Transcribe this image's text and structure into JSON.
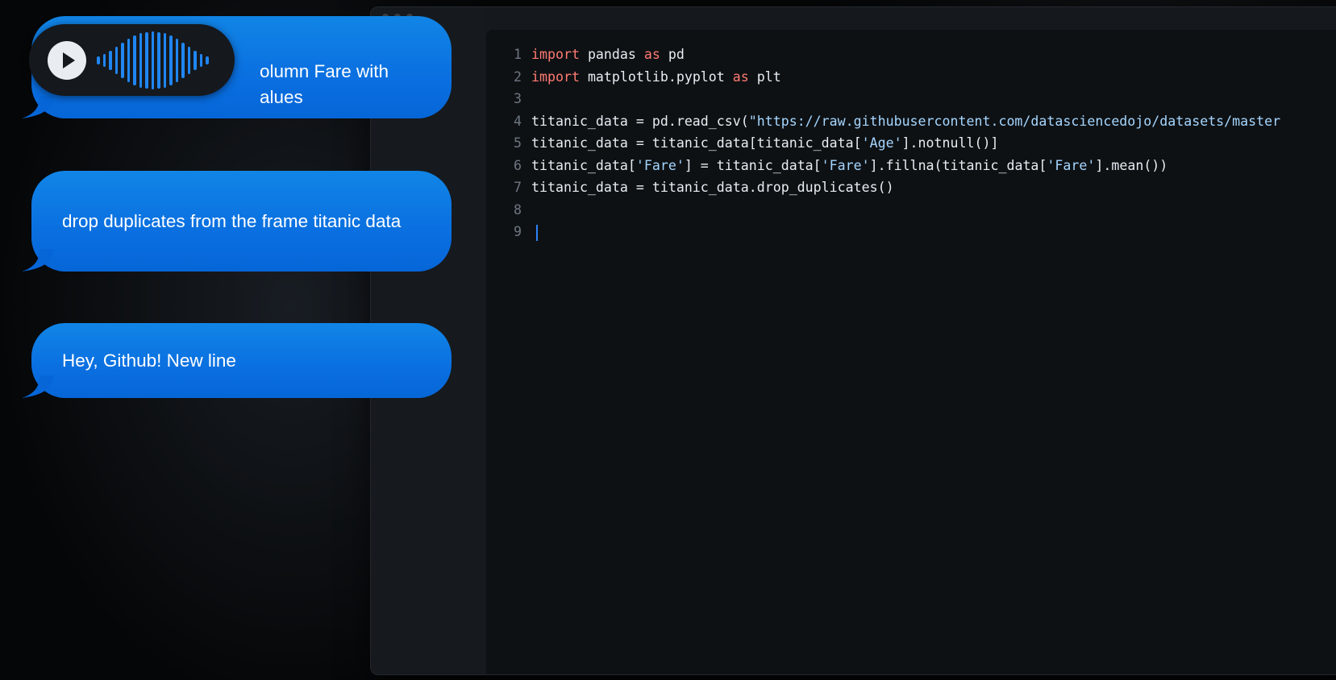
{
  "chat": {
    "messages": [
      {
        "line1": "olumn Fare with",
        "line2": "alues"
      },
      {
        "text": "drop duplicates from the frame titanic data"
      },
      {
        "text": "Hey, Github! New line"
      }
    ],
    "voice": {
      "icon": "play-icon"
    }
  },
  "editor": {
    "lines": [
      {
        "n": "1",
        "parts": [
          {
            "t": "import",
            "c": "kw"
          },
          {
            "t": " pandas "
          },
          {
            "t": "as",
            "c": "kw"
          },
          {
            "t": " pd"
          }
        ]
      },
      {
        "n": "2",
        "parts": [
          {
            "t": "import",
            "c": "kw"
          },
          {
            "t": " matplotlib.pyplot "
          },
          {
            "t": "as",
            "c": "kw"
          },
          {
            "t": " plt"
          }
        ]
      },
      {
        "n": "3",
        "parts": []
      },
      {
        "n": "4",
        "parts": [
          {
            "t": "titanic_data = pd.read_csv("
          },
          {
            "t": "\"https://raw.githubusercontent.com/datasciencedojo/datasets/master",
            "c": "str"
          }
        ]
      },
      {
        "n": "5",
        "parts": [
          {
            "t": "titanic_data = titanic_data[titanic_data["
          },
          {
            "t": "'Age'",
            "c": "str"
          },
          {
            "t": "].notnull()]"
          }
        ]
      },
      {
        "n": "6",
        "parts": [
          {
            "t": "titanic_data["
          },
          {
            "t": "'Fare'",
            "c": "str"
          },
          {
            "t": "] = titanic_data["
          },
          {
            "t": "'Fare'",
            "c": "str"
          },
          {
            "t": "].fillna(titanic_data["
          },
          {
            "t": "'Fare'",
            "c": "str"
          },
          {
            "t": "].mean())"
          }
        ]
      },
      {
        "n": "7",
        "parts": [
          {
            "t": "titanic_data = titanic_data.drop_duplicates()"
          }
        ]
      },
      {
        "n": "8",
        "parts": []
      },
      {
        "n": "9",
        "parts": [],
        "caret": true
      }
    ]
  },
  "colors": {
    "keyword": "#ff7b72",
    "string": "#a5d6ff",
    "bubble": "#0a6fe0"
  }
}
